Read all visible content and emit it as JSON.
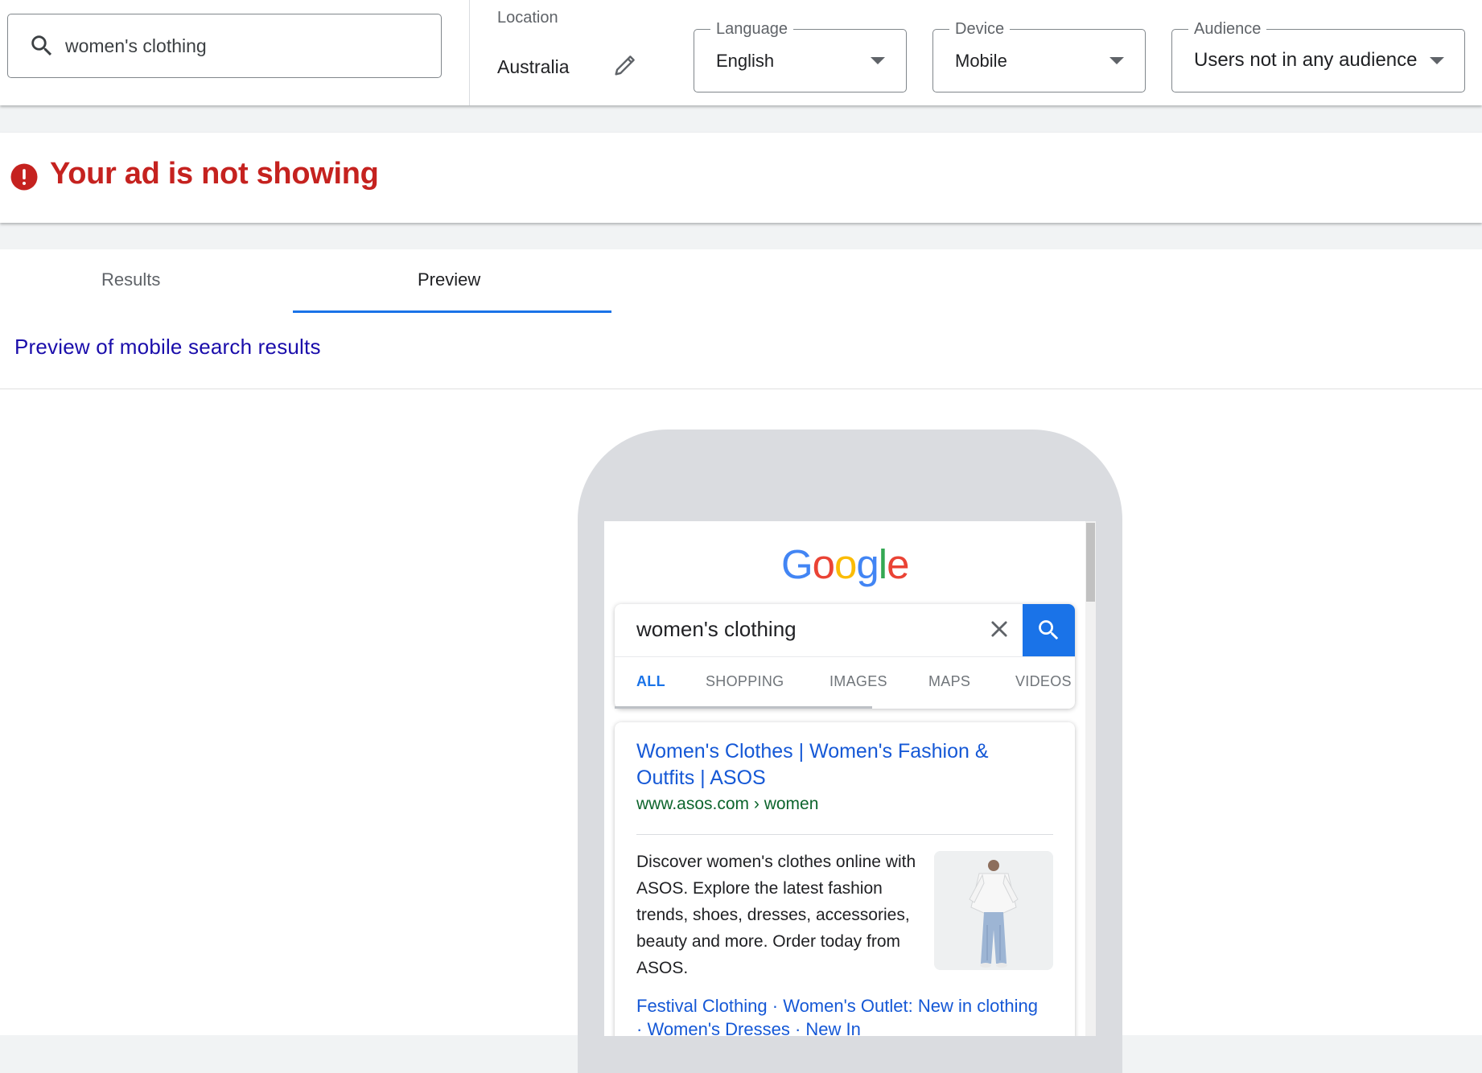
{
  "filters": {
    "search_query": "women's clothing",
    "location": {
      "label": "Location",
      "value": "Australia"
    },
    "language": {
      "label": "Language",
      "value": "English"
    },
    "device": {
      "label": "Device",
      "value": "Mobile"
    },
    "audience": {
      "label": "Audience",
      "value": "Users not in any audience"
    }
  },
  "banner": {
    "message": "Your ad is not showing",
    "color": "#c5221f"
  },
  "tabs": [
    {
      "label": "Results",
      "active": false
    },
    {
      "label": "Preview",
      "active": true
    }
  ],
  "preview_title": "Preview of mobile search results",
  "phone": {
    "logo": "Google",
    "search_query": "women's clothing",
    "search_tabs": [
      "ALL",
      "SHOPPING",
      "IMAGES",
      "MAPS",
      "VIDEOS"
    ],
    "active_search_tab": "ALL",
    "result": {
      "title": "Women's Clothes | Women's Fashion & Outfits | ASOS",
      "url": "www.asos.com › women",
      "snippet": "Discover women's clothes online with ASOS. Explore the latest fashion trends, shoes, dresses, accessories, beauty and more. Order today from ASOS.",
      "sitelinks": [
        "Festival Clothing",
        "Women's Outlet: New in clothing",
        "Women's Dresses",
        "New In"
      ]
    }
  },
  "colors": {
    "accent": "#1a73e8",
    "link": "#1558d6",
    "url_green": "#0d652d",
    "error": "#c5221f"
  }
}
